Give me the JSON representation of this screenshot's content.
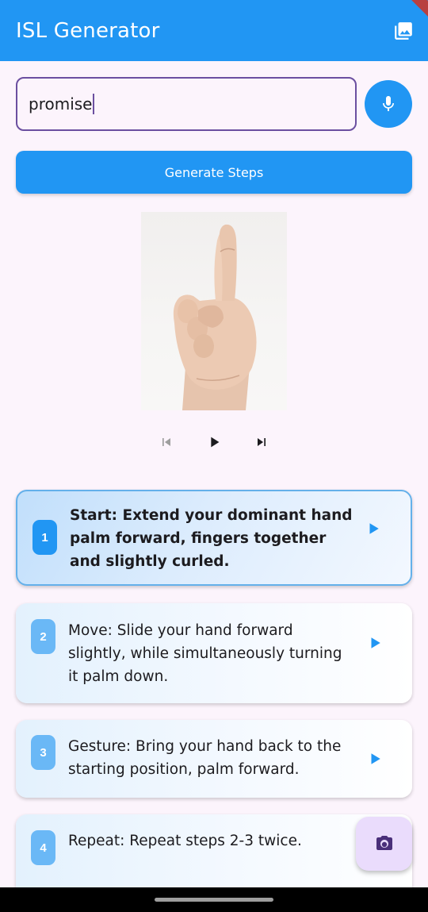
{
  "app": {
    "title": "ISL Generator"
  },
  "input": {
    "value": "promise"
  },
  "generate_button": {
    "label": "Generate Steps"
  },
  "player": {
    "prev_icon": "skip-previous-icon",
    "play_icon": "play-icon",
    "next_icon": "skip-next-icon"
  },
  "steps": [
    {
      "number": "1",
      "text": "Start: Extend your dominant hand palm forward, fingers together and slightly curled.",
      "active": true
    },
    {
      "number": "2",
      "text": "Move: Slide your hand forward slightly, while simultaneously turning it palm down.",
      "active": false
    },
    {
      "number": "3",
      "text": "Gesture: Bring your hand back to the starting position, palm forward.",
      "active": false
    },
    {
      "number": "4",
      "text": "Repeat: Repeat steps 2-3 twice.",
      "active": false
    }
  ],
  "colors": {
    "primary": "#2196f3",
    "field_border": "#6b4fa0",
    "fab_bg": "#eadcfc",
    "fab_icon": "#4a2f7a",
    "disabled": "#9e9e9e"
  }
}
